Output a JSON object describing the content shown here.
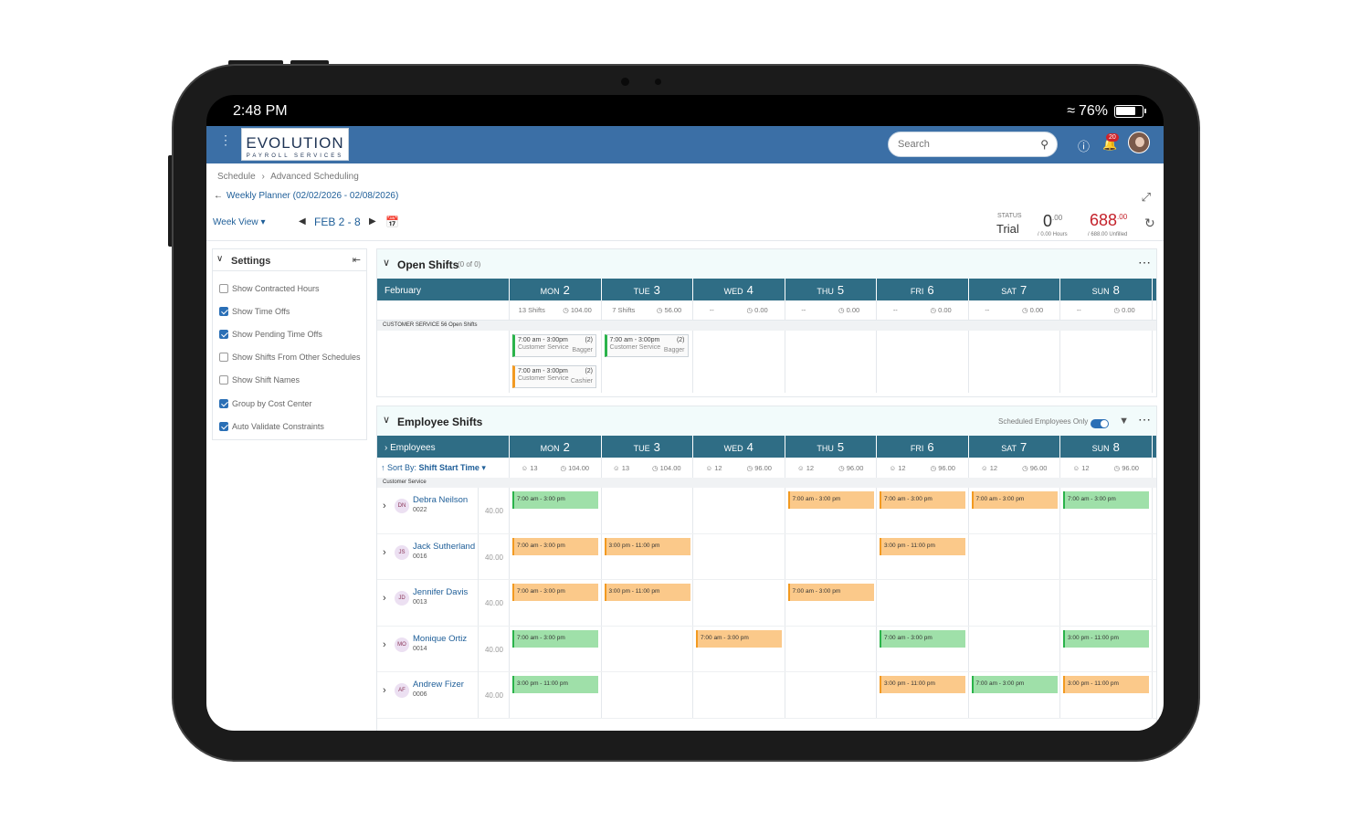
{
  "device": {
    "time": "2:48 PM",
    "battery": "76%"
  },
  "header": {
    "logo_main": "EVOLUTION",
    "logo_sub": "PAYROLL SERVICES",
    "search_placeholder": "Search",
    "notifications": "20"
  },
  "breadcrumb": {
    "root": "Schedule",
    "sep": "›",
    "current": "Advanced Scheduling"
  },
  "page_title": "Weekly Planner (02/02/2026 - 02/08/2026)",
  "toolbar": {
    "view": "Week View",
    "range": "FEB 2 - 8",
    "status_label": "STATUS",
    "status_value": "Trial",
    "hours_value": "0",
    "hours_decimal": ".00",
    "hours_sub": "/ 0.00 Hours",
    "unfilled_value": "688",
    "unfilled_decimal": ".00",
    "unfilled_sub": "/ 688.00 Unfilled"
  },
  "settings": {
    "title": "Settings",
    "items": [
      {
        "label": "Show Contracted Hours",
        "checked": false
      },
      {
        "label": "Show Time Offs",
        "checked": true
      },
      {
        "label": "Show Pending Time Offs",
        "checked": true
      },
      {
        "label": "Show Shifts From Other Schedules",
        "checked": false
      },
      {
        "label": "Show Shift Names",
        "checked": false
      },
      {
        "label": "Group by Cost Center",
        "checked": true
      },
      {
        "label": "Auto Validate Constraints",
        "checked": true
      }
    ]
  },
  "days": [
    {
      "name": "MON",
      "num": "2"
    },
    {
      "name": "TUE",
      "num": "3"
    },
    {
      "name": "WED",
      "num": "4"
    },
    {
      "name": "THU",
      "num": "5"
    },
    {
      "name": "FRI",
      "num": "6"
    },
    {
      "name": "SAT",
      "num": "7"
    },
    {
      "name": "SUN",
      "num": "8"
    }
  ],
  "open_shifts": {
    "title": "Open Shifts",
    "count": "(0 of 0)",
    "month": "February",
    "stats": [
      {
        "a": "13 Shifts",
        "b": "104.00"
      },
      {
        "a": "7 Shifts",
        "b": "56.00"
      },
      {
        "a": "--",
        "b": "0.00"
      },
      {
        "a": "--",
        "b": "0.00"
      },
      {
        "a": "--",
        "b": "0.00"
      },
      {
        "a": "--",
        "b": "0.00"
      },
      {
        "a": "--",
        "b": "0.00"
      }
    ],
    "group": "CUSTOMER SERVICE    56 Open Shifts",
    "shifts": [
      {
        "time": "7:00 am - 3:00pm",
        "dept": "Customer Service",
        "role": "Bagger",
        "count": "(2)"
      },
      {
        "time": "7:00 am - 3:00pm",
        "dept": "Customer Service",
        "role": "Cashier",
        "count": "(2)"
      },
      {
        "time": "7:00 am - 3:00pm",
        "dept": "Customer Service",
        "role": "Bagger",
        "count": "(2)"
      }
    ]
  },
  "employee_shifts": {
    "title": "Employee Shifts",
    "scheduled_only": "Scheduled Employees Only",
    "employees_label": "Employees",
    "sort_label": "Sort By:",
    "sort_value": "Shift Start Time",
    "stats": [
      {
        "a": "13",
        "b": "104.00"
      },
      {
        "a": "13",
        "b": "104.00"
      },
      {
        "a": "12",
        "b": "96.00"
      },
      {
        "a": "12",
        "b": "96.00"
      },
      {
        "a": "12",
        "b": "96.00"
      },
      {
        "a": "12",
        "b": "96.00"
      },
      {
        "a": "12",
        "b": "96.00"
      }
    ],
    "group": "Customer Service",
    "employees": [
      {
        "initials": "DN",
        "name": "Debra Neilson",
        "id": "0022",
        "hours": "40.00",
        "shifts": [
          {
            "t": "7:00 am - 3:00 pm",
            "c": "g"
          },
          null,
          null,
          {
            "t": "7:00 am - 3:00 pm",
            "c": "o"
          },
          {
            "t": "7:00 am - 3:00 pm",
            "c": "o"
          },
          {
            "t": "7:00 am - 3:00 pm",
            "c": "o"
          },
          {
            "t": "7:00 am - 3:00 pm",
            "c": "g"
          }
        ]
      },
      {
        "initials": "JS",
        "name": "Jack Sutherland",
        "id": "0016",
        "hours": "40.00",
        "shifts": [
          {
            "t": "7:00 am - 3:00 pm",
            "c": "o"
          },
          {
            "t": "3:00 pm - 11:00 pm",
            "c": "o"
          },
          null,
          null,
          {
            "t": "3:00 pm - 11:00 pm",
            "c": "o"
          },
          null,
          null
        ]
      },
      {
        "initials": "JD",
        "name": "Jennifer Davis",
        "id": "0013",
        "hours": "40.00",
        "shifts": [
          {
            "t": "7:00 am - 3:00 pm",
            "c": "o"
          },
          {
            "t": "3:00 pm - 11:00 pm",
            "c": "o"
          },
          null,
          {
            "t": "7:00 am - 3:00 pm",
            "c": "o"
          },
          null,
          null,
          null
        ]
      },
      {
        "initials": "MO",
        "name": "Monique Ortiz",
        "id": "0014",
        "hours": "40.00",
        "shifts": [
          {
            "t": "7:00 am - 3:00 pm",
            "c": "g"
          },
          null,
          {
            "t": "7:00 am - 3:00 pm",
            "c": "o"
          },
          null,
          {
            "t": "7:00 am - 3:00 pm",
            "c": "g"
          },
          null,
          {
            "t": "3:00 pm - 11:00 pm",
            "c": "g"
          }
        ]
      },
      {
        "initials": "AF",
        "name": "Andrew Fizer",
        "id": "0006",
        "hours": "40.00",
        "shifts": [
          {
            "t": "3:00 pm - 11:00 pm",
            "c": "g"
          },
          null,
          null,
          null,
          {
            "t": "3:00 pm - 11:00 pm",
            "c": "o"
          },
          {
            "t": "7:00 am - 3:00 pm",
            "c": "g"
          },
          {
            "t": "3:00 pm - 11:00 pm",
            "c": "o"
          }
        ]
      }
    ]
  }
}
